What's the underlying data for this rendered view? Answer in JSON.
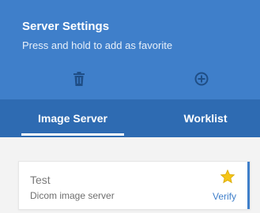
{
  "header": {
    "title": "Server Settings",
    "subtitle": "Press and hold to add as favorite"
  },
  "toolbar": {
    "delete_icon": "trash-icon",
    "add_icon": "plus-circle-icon"
  },
  "tabs": [
    {
      "label": "Image Server",
      "active": true
    },
    {
      "label": "Worklist",
      "active": false
    }
  ],
  "servers": [
    {
      "name": "Test",
      "description": "Dicom image server",
      "favorite": true,
      "action_label": "Verify"
    }
  ],
  "colors": {
    "header": "#3f7fca",
    "tabs": "#2e6bb2",
    "star": "#f5c518",
    "link": "#3f7fca"
  }
}
